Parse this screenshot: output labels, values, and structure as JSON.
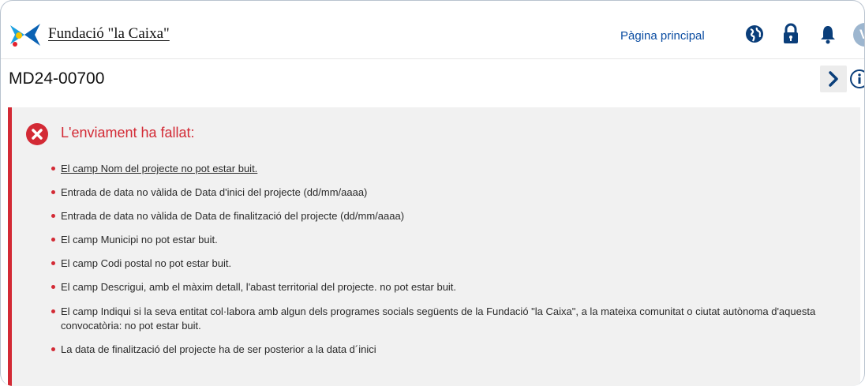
{
  "header": {
    "brand": "Fundació \"la Caixa\"",
    "home_link": "Pàgina principal",
    "avatar_initial": "V",
    "icons": [
      "globe-icon",
      "lock-icon",
      "bell-icon"
    ]
  },
  "page": {
    "title": "MD24-00700"
  },
  "error": {
    "title": "L'enviament ha fallat:",
    "items": [
      "El camp Nom del projecte no pot estar buit.",
      "Entrada de data no vàlida de Data d'inici del projecte (dd/mm/aaaa)",
      "Entrada de data no vàlida de Data de finalització del projecte (dd/mm/aaaa)",
      "El camp Municipi no pot estar buit.",
      "El camp Codi postal no pot estar buit.",
      "El camp Descrigui, amb el màxim detall, l'abast territorial del projecte. no pot estar buit.",
      "El camp Indiqui si la seva entitat col·labora amb algun dels programes socials següents de la Fundació \"la Caixa\", a la mateixa comunitat o ciutat autònoma d'aquesta convocatòria: no pot estar buit.",
      "La data de finalització del projecte ha de ser posterior a la data d´inici"
    ]
  },
  "colors": {
    "error_red": "#d32a35",
    "link_blue": "#0b4da2",
    "nav_icon": "#0a3e7a",
    "panel_bg": "#f1f1f1"
  }
}
